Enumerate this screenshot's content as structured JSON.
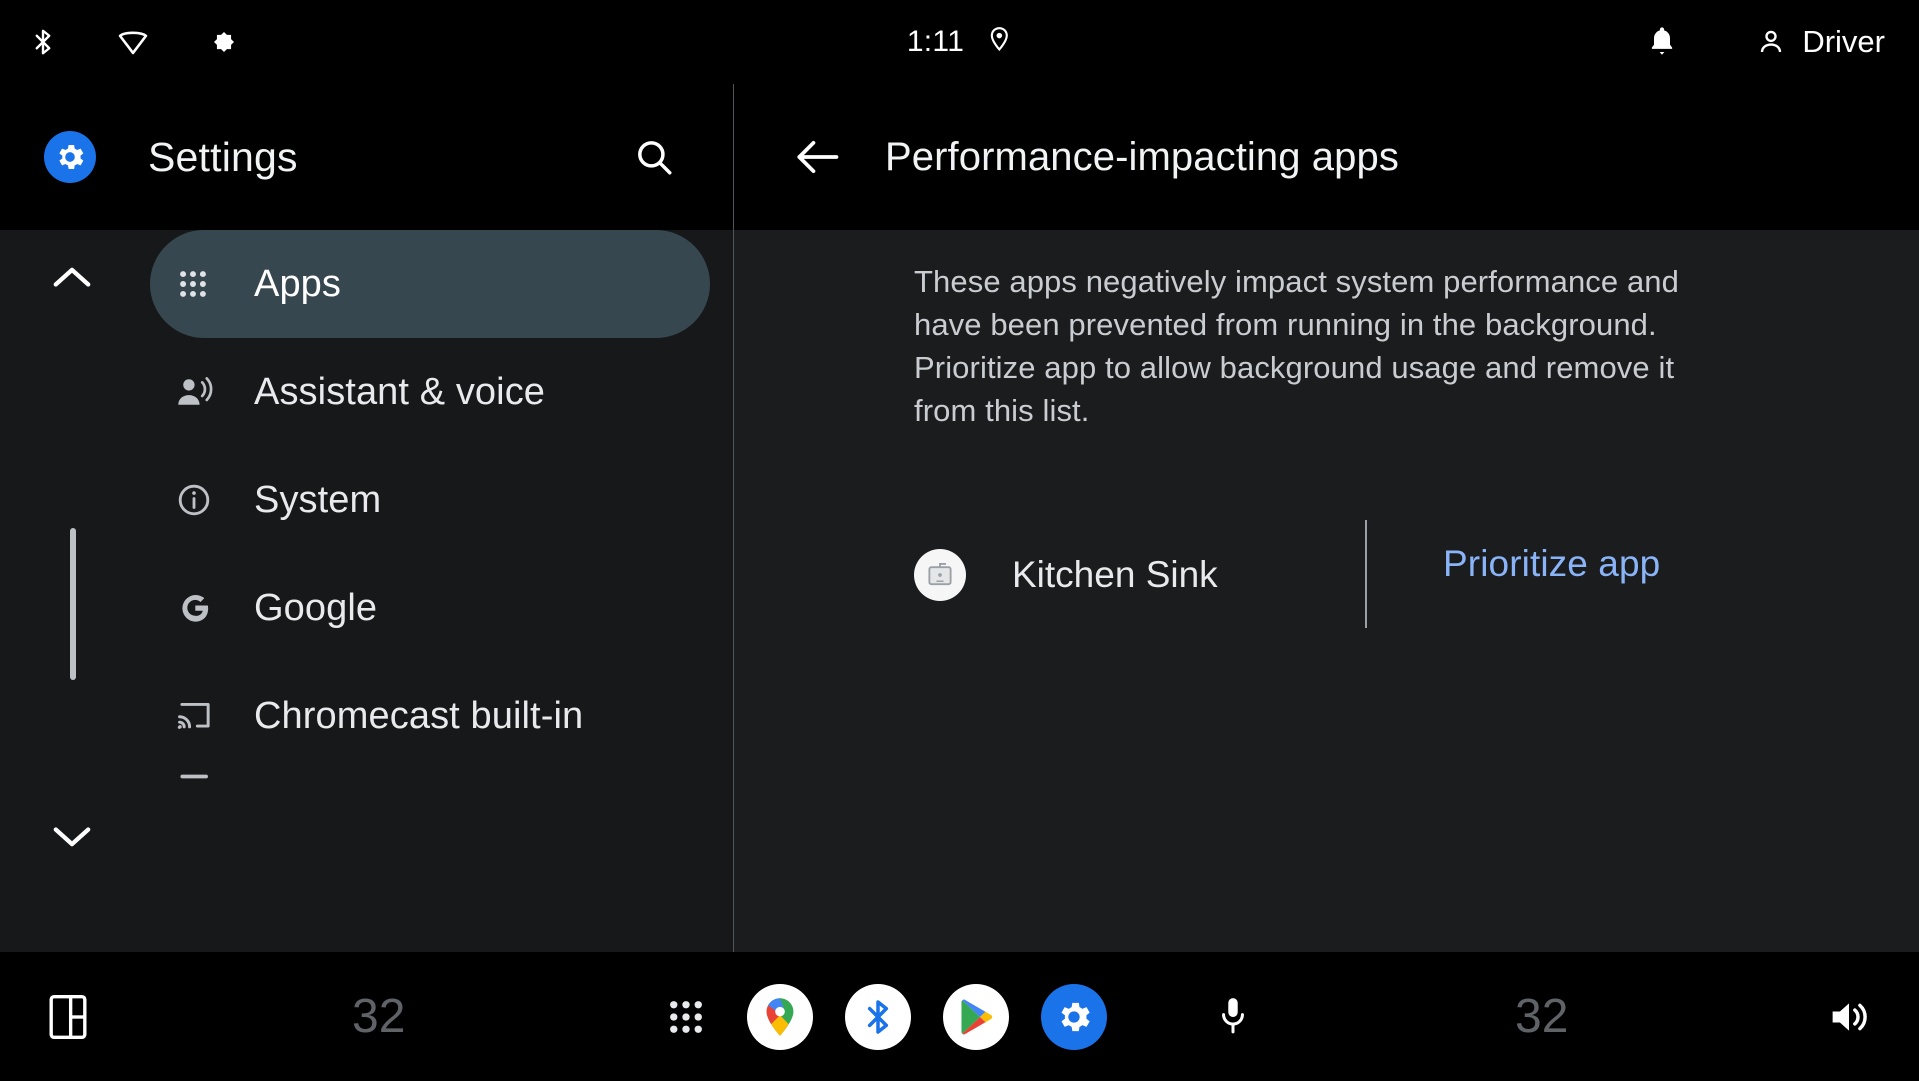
{
  "statusbar": {
    "icons_left": [
      "bluetooth-icon",
      "wifi-icon",
      "brightness-icon"
    ],
    "time": "1:11",
    "location_icon": "location-pin-icon",
    "notification_icon": "bell-icon",
    "user_label": "Driver",
    "user_icon": "person-icon"
  },
  "left_panel": {
    "app_icon": "settings-gear-icon",
    "title": "Settings",
    "search_icon": "search-icon",
    "scroll_up_icon": "chevron-up-icon",
    "scroll_down_icon": "chevron-down-icon",
    "items": [
      {
        "label": "Apps",
        "icon": "apps-grid-icon",
        "selected": true
      },
      {
        "label": "Assistant & voice",
        "icon": "assistant-voice-icon",
        "selected": false
      },
      {
        "label": "System",
        "icon": "info-circle-icon",
        "selected": false
      },
      {
        "label": "Google",
        "icon": "google-g-icon",
        "selected": false
      },
      {
        "label": "Chromecast built-in",
        "icon": "cast-icon",
        "selected": false
      }
    ]
  },
  "right_panel": {
    "back_icon": "arrow-left-icon",
    "title": "Performance-impacting apps",
    "description_line1": "These apps negatively impact system performance and have been prevented from running in the background.",
    "description_line2": "Prioritize app to allow background usage and remove it from this list.",
    "app_row": {
      "app_icon": "kitchen-sink-app-icon",
      "app_name": "Kitchen Sink",
      "action_label": "Prioritize app"
    }
  },
  "taskbar": {
    "panel_icon": "split-screen-icon",
    "temperature_left": "32",
    "temperature_right": "32",
    "grid_icon": "apps-grid-icon",
    "apps": [
      {
        "name": "maps-icon"
      },
      {
        "name": "bluetooth-icon"
      },
      {
        "name": "play-store-icon"
      },
      {
        "name": "settings-gear-icon"
      }
    ],
    "mic_icon": "microphone-icon",
    "volume_icon": "volume-icon"
  },
  "colors": {
    "accent_blue": "#1a73e8",
    "link_blue": "#8ab4f8",
    "selected_item_bg": "#37474f",
    "sidebar_bg": "#17181a",
    "content_bg": "#1b1c1e",
    "header_bg": "#000000"
  }
}
